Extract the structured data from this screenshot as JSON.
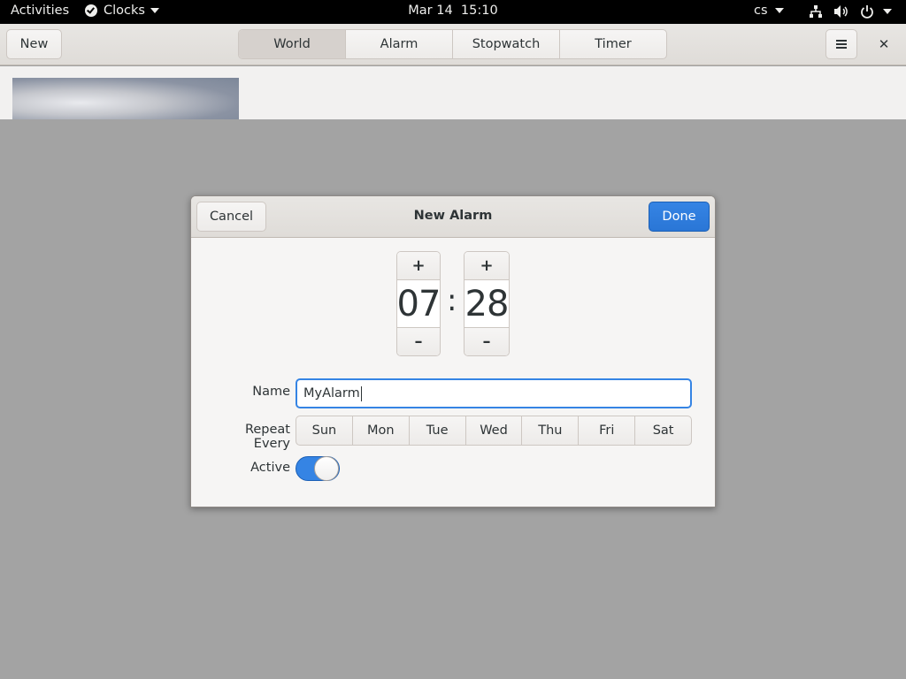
{
  "topbar": {
    "activities": "Activities",
    "app_name": "Clocks",
    "clock": "Mar 14  15:10",
    "language": "cs",
    "icons": [
      "network-icon",
      "volume-icon",
      "power-icon"
    ]
  },
  "header": {
    "new_label": "New",
    "tabs": [
      {
        "label": "World",
        "active": true
      },
      {
        "label": "Alarm",
        "active": false
      },
      {
        "label": "Stopwatch",
        "active": false
      },
      {
        "label": "Timer",
        "active": false
      }
    ],
    "close_symbol": "✕"
  },
  "dialog": {
    "title": "New Alarm",
    "cancel_label": "Cancel",
    "done_label": "Done",
    "hour": "07",
    "minute": "28",
    "separator": ":",
    "plus": "+",
    "minus": "–",
    "name_label": "Name",
    "name_value": "MyAlarm",
    "repeat_label": "Repeat Every",
    "days": [
      "Sun",
      "Mon",
      "Tue",
      "Wed",
      "Thu",
      "Fri",
      "Sat"
    ],
    "active_label": "Active",
    "active": true
  },
  "colors": {
    "accent": "#3584e4",
    "topbar": "#000000",
    "backdrop": "#a3a3a3"
  }
}
